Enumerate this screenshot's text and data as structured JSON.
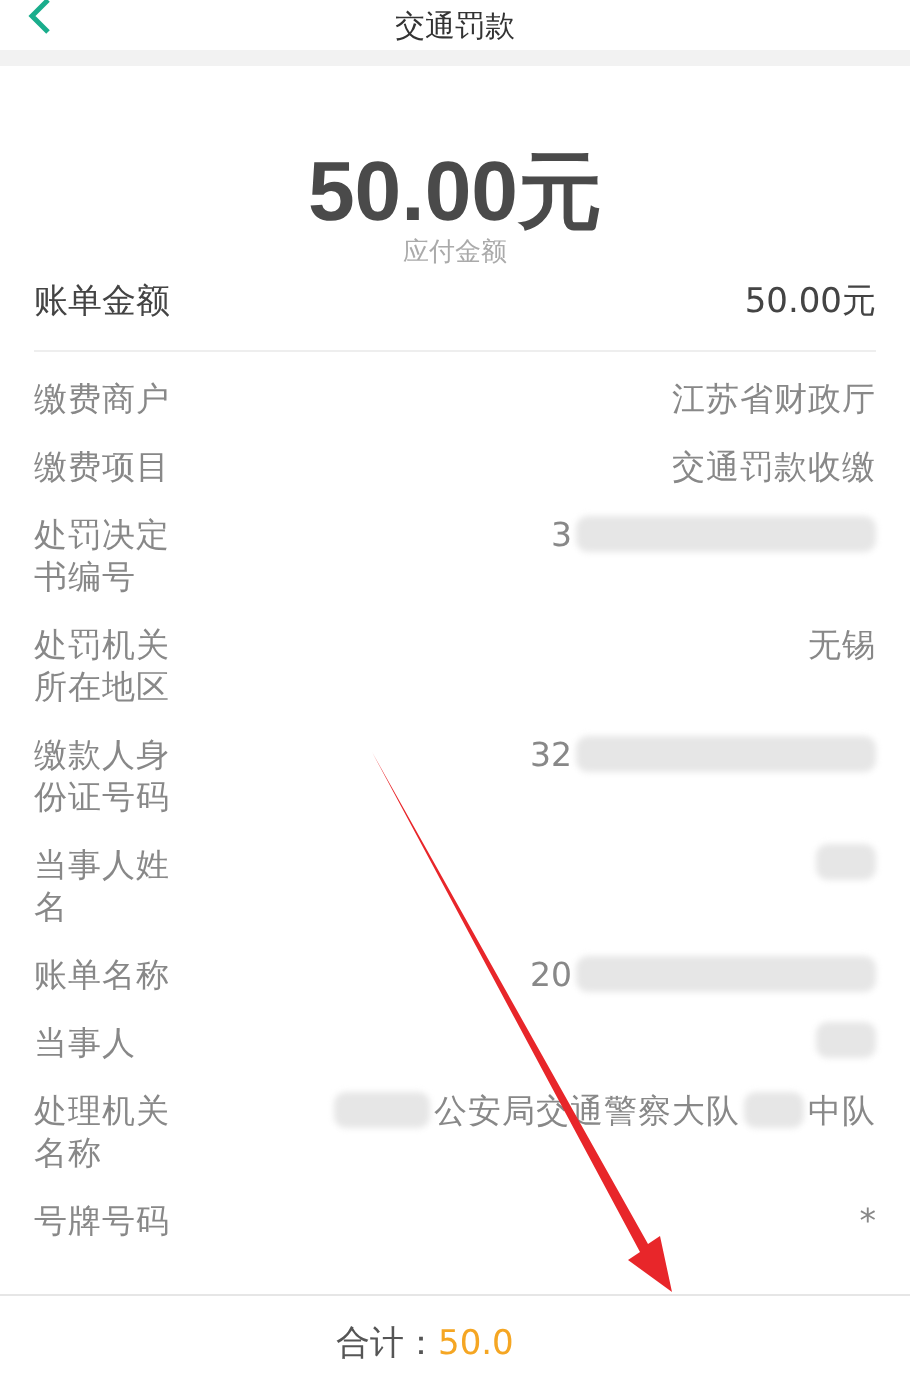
{
  "header": {
    "title": "交通罚款"
  },
  "summary": {
    "amount": "50.00元",
    "caption": "应付金额"
  },
  "bill_total": {
    "label": "账单金额",
    "value": "50.00元"
  },
  "rows": [
    {
      "label": "缴费商户",
      "value": [
        {
          "kind": "text",
          "text": "江苏省财政厅"
        }
      ]
    },
    {
      "label": "缴费项目",
      "value": [
        {
          "kind": "text",
          "text": "交通罚款收缴"
        }
      ]
    },
    {
      "label": "处罚决定书编号",
      "value": [
        {
          "kind": "text",
          "text": "3"
        },
        {
          "kind": "blur"
        }
      ]
    },
    {
      "label": "处罚机关所在地区",
      "value": [
        {
          "kind": "text",
          "text": "无锡"
        }
      ]
    },
    {
      "label": "缴款人身份证号码",
      "value": [
        {
          "kind": "text",
          "text": "32"
        },
        {
          "kind": "blur"
        }
      ]
    },
    {
      "label": "当事人姓名",
      "value": [
        {
          "kind": "blur"
        }
      ]
    },
    {
      "label": "账单名称",
      "value": [
        {
          "kind": "text",
          "text": "20"
        },
        {
          "kind": "blur"
        }
      ]
    },
    {
      "label": "当事人",
      "value": [
        {
          "kind": "blur"
        }
      ]
    },
    {
      "label": "处理机关名称",
      "value": [
        {
          "kind": "blur"
        },
        {
          "kind": "text",
          "text": "公安局交通警察大队"
        },
        {
          "kind": "blur"
        },
        {
          "kind": "text",
          "text": "中队"
        }
      ]
    },
    {
      "label": "号牌号码",
      "value": [
        {
          "kind": "text",
          "text": "*"
        }
      ]
    }
  ],
  "footer": {
    "total_label": "合计：",
    "total_value": "50.0"
  }
}
